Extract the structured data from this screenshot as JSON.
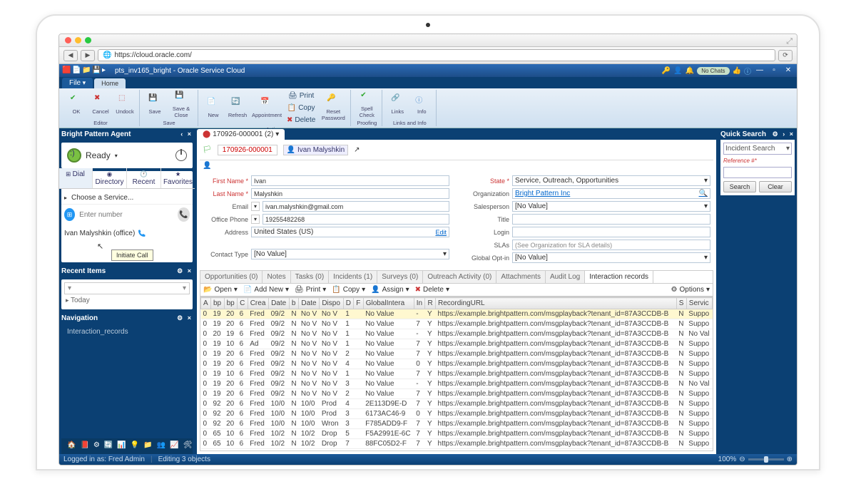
{
  "browser": {
    "url": "https://cloud.oracle.com/"
  },
  "title": "pts_inv165_bright - Oracle Service Cloud",
  "topTabs": {
    "file": "File",
    "home": "Home"
  },
  "ribbon": {
    "editor": {
      "label": "Editor",
      "ok": "OK",
      "cancel": "Cancel",
      "undock": "Undock"
    },
    "save": {
      "label": "Save",
      "save": "Save",
      "saveClose": "Save & Close"
    },
    "actions": {
      "label": "Actions",
      "new": "New",
      "refresh": "Refresh",
      "appointment": "Appointment",
      "print": "Print",
      "copy": "Copy",
      "delete": "Delete",
      "resetPw": "Reset Password"
    },
    "proofing": {
      "label": "Proofing",
      "spell": "Spell Check"
    },
    "links": {
      "label": "Links and Info",
      "links": "Links",
      "info": "Info"
    },
    "chats": "No Chats"
  },
  "agent": {
    "title": "Bright Pattern Agent",
    "status": "Ready",
    "tabs": {
      "dial": "Dial",
      "directory": "Directory",
      "recent": "Recent",
      "favorites": "Favorites"
    },
    "choose": "Choose a Service...",
    "placeholder": "Enter number",
    "contact": "Ivan Malyshkin (office)",
    "tooltip": "Initiate Call"
  },
  "recent": {
    "title": "Recent Items",
    "today": "Today"
  },
  "nav": {
    "title": "Navigation",
    "item": "Interaction_records"
  },
  "docTab": "170926-000001 (2)",
  "formTabs": {
    "incident": "170926-000001",
    "person": "Ivan Malyshkin"
  },
  "form": {
    "firstNameL": "First Name *",
    "firstName": "Ivan",
    "lastNameL": "Last Name *",
    "lastName": "Malyshkin",
    "emailL": "Email",
    "email": "ivan.malyshkin@gmail.com",
    "officeL": "Office Phone",
    "office": "19255482268",
    "addressL": "Address",
    "address": "United States (US)",
    "edit": "Edit",
    "contactTypeL": "Contact Type",
    "contactType": "[No Value]",
    "stateL": "State *",
    "state": "Service, Outreach, Opportunities",
    "orgL": "Organization",
    "org": "Bright Pattern Inc",
    "salesL": "Salesperson",
    "sales": "[No Value]",
    "titleL": "Title",
    "title": "",
    "loginL": "Login",
    "login": "",
    "slasL": "SLAs",
    "slas": "(See Organization for SLA details)",
    "optL": "Global Opt-in",
    "opt": "[No Value]"
  },
  "subTabs": [
    "Opportunities (0)",
    "Notes",
    "Tasks (0)",
    "Incidents (1)",
    "Surveys (0)",
    "Outreach Activity (0)",
    "Attachments",
    "Audit Log",
    "Interaction records"
  ],
  "tblBar": {
    "open": "Open",
    "add": "Add New",
    "print": "Print",
    "copy": "Copy",
    "assign": "Assign",
    "delete": "Delete",
    "options": "Options"
  },
  "cols": [
    "A",
    "bp",
    "bp",
    "C",
    "Crea",
    "Date",
    "b",
    "Date",
    "Dispo",
    "D",
    "F",
    "GlobalIntera",
    "In",
    "R",
    "RecordingURL",
    "S",
    "Servic"
  ],
  "rows": [
    [
      "0",
      "19",
      "20",
      "6",
      "Fred",
      "09/2",
      "N",
      "No V",
      "No V",
      "1",
      "",
      "No Value",
      "-",
      "Y",
      "https://example.brightpattern.com/msgplayback?tenant_id=87A3CCDB-B",
      "N",
      "Suppo"
    ],
    [
      "0",
      "19",
      "20",
      "6",
      "Fred",
      "09/2",
      "N",
      "No V",
      "No V",
      "1",
      "",
      "No Value",
      "7",
      "Y",
      "https://example.brightpattern.com/msgplayback?tenant_id=87A3CCDB-B",
      "N",
      "Suppo"
    ],
    [
      "0",
      "20",
      "19",
      "6",
      "Fred",
      "09/2",
      "N",
      "No V",
      "No V",
      "1",
      "",
      "No Value",
      "-",
      "Y",
      "https://example.brightpattern.com/msgplayback?tenant_id=87A3CCDB-B",
      "N",
      "No Val"
    ],
    [
      "0",
      "19",
      "10",
      "6",
      "Ad",
      "09/2",
      "N",
      "No V",
      "No V",
      "1",
      "",
      "No Value",
      "7",
      "Y",
      "https://example.brightpattern.com/msgplayback?tenant_id=87A3CCDB-B",
      "N",
      "Suppo"
    ],
    [
      "0",
      "19",
      "20",
      "6",
      "Fred",
      "09/2",
      "N",
      "No V",
      "No V",
      "2",
      "",
      "No Value",
      "7",
      "Y",
      "https://example.brightpattern.com/msgplayback?tenant_id=87A3CCDB-B",
      "N",
      "Suppo"
    ],
    [
      "0",
      "19",
      "20",
      "6",
      "Fred",
      "09/2",
      "N",
      "No V",
      "No V",
      "4",
      "",
      "No Value",
      "0",
      "Y",
      "https://example.brightpattern.com/msgplayback?tenant_id=87A3CCDB-B",
      "N",
      "Suppo"
    ],
    [
      "0",
      "19",
      "10",
      "6",
      "Fred",
      "09/2",
      "N",
      "No V",
      "No V",
      "1",
      "",
      "No Value",
      "7",
      "Y",
      "https://example.brightpattern.com/msgplayback?tenant_id=87A3CCDB-B",
      "N",
      "Suppo"
    ],
    [
      "0",
      "19",
      "20",
      "6",
      "Fred",
      "09/2",
      "N",
      "No V",
      "No V",
      "3",
      "",
      "No Value",
      "-",
      "Y",
      "https://example.brightpattern.com/msgplayback?tenant_id=87A3CCDB-B",
      "N",
      "No Val"
    ],
    [
      "0",
      "19",
      "20",
      "6",
      "Fred",
      "09/2",
      "N",
      "No V",
      "No V",
      "2",
      "",
      "No Value",
      "7",
      "Y",
      "https://example.brightpattern.com/msgplayback?tenant_id=87A3CCDB-B",
      "N",
      "Suppo"
    ],
    [
      "0",
      "92",
      "20",
      "6",
      "Fred",
      "10/0",
      "N",
      "10/0",
      "Prod",
      "4",
      "",
      "2E113D9E-D",
      "7",
      "Y",
      "https://example.brightpattern.com/msgplayback?tenant_id=87A3CCDB-B",
      "N",
      "Suppo"
    ],
    [
      "0",
      "92",
      "20",
      "6",
      "Fred",
      "10/0",
      "N",
      "10/0",
      "Prod",
      "3",
      "",
      "6173AC46-9",
      "0",
      "Y",
      "https://example.brightpattern.com/msgplayback?tenant_id=87A3CCDB-B",
      "N",
      "Suppo"
    ],
    [
      "0",
      "92",
      "20",
      "6",
      "Fred",
      "10/0",
      "N",
      "10/0",
      "Wron",
      "3",
      "",
      "F785ADD9-F",
      "7",
      "Y",
      "https://example.brightpattern.com/msgplayback?tenant_id=87A3CCDB-B",
      "N",
      "Suppo"
    ],
    [
      "0",
      "65",
      "10",
      "6",
      "Fred",
      "10/2",
      "N",
      "10/2",
      "Drop",
      "5",
      "",
      "F5A2991E-6C",
      "7",
      "Y",
      "https://example.brightpattern.com/msgplayback?tenant_id=87A3CCDB-B",
      "N",
      "Suppo"
    ],
    [
      "0",
      "65",
      "10",
      "6",
      "Fred",
      "10/2",
      "N",
      "10/2",
      "Drop",
      "7",
      "",
      "88FC05D2-F",
      "7",
      "Y",
      "https://example.brightpattern.com/msgplayback?tenant_id=87A3CCDB-B",
      "N",
      "Suppo"
    ]
  ],
  "search": {
    "title": "Quick Search",
    "type": "Incident Search",
    "ref": "Reference #*",
    "search": "Search",
    "clear": "Clear"
  },
  "status": {
    "user": "Logged in as: Fred Admin",
    "editing": "Editing 3 objects",
    "zoom": "100%"
  }
}
